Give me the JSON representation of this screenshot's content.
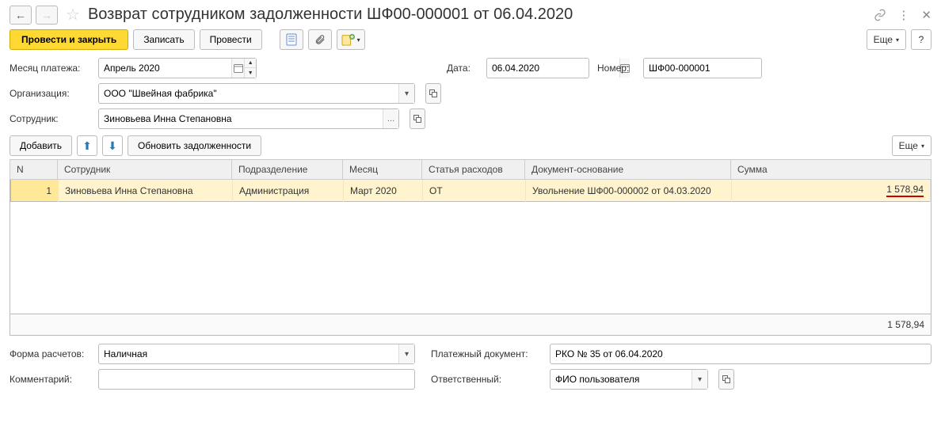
{
  "window": {
    "title": "Возврат сотрудником задолженности ШФ00-000001 от 06.04.2020"
  },
  "toolbar": {
    "post_close": "Провести и закрыть",
    "save": "Записать",
    "post": "Провести",
    "more": "Еще"
  },
  "fields": {
    "pay_month_label": "Месяц платежа:",
    "pay_month": "Апрель 2020",
    "date_label": "Дата:",
    "date": "06.04.2020",
    "number_label": "Номер:",
    "number": "ШФ00-000001",
    "org_label": "Организация:",
    "org": "ООО \"Швейная фабрика\"",
    "employee_label": "Сотрудник:",
    "employee": "Зиновьева Инна Степановна"
  },
  "table_toolbar": {
    "add": "Добавить",
    "refresh": "Обновить задолженности",
    "more": "Еще"
  },
  "table": {
    "headers": {
      "n": "N",
      "emp": "Сотрудник",
      "dep": "Подразделение",
      "month": "Месяц",
      "expense": "Статья расходов",
      "doc": "Документ-основание",
      "sum": "Сумма"
    },
    "rows": [
      {
        "n": "1",
        "emp": "Зиновьева Инна Степановна",
        "dep": "Администрация",
        "month": "Март 2020",
        "expense": "ОТ",
        "doc": "Увольнение ШФ00-000002 от 04.03.2020",
        "sum": "1 578,94"
      }
    ],
    "total": "1 578,94"
  },
  "footer": {
    "payform_label": "Форма расчетов:",
    "payform": "Наличная",
    "paydoc_label": "Платежный документ:",
    "paydoc": "РКО № 35 от 06.04.2020",
    "comment_label": "Комментарий:",
    "responsible_label": "Ответственный:",
    "responsible": "ФИО пользователя"
  }
}
